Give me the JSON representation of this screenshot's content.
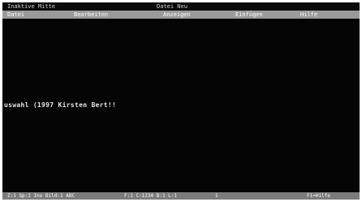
{
  "titlebar": {
    "left_text": "Inaktive Mitte",
    "center_text": "Datei Neu"
  },
  "menu": {
    "items": [
      {
        "label": "Datei"
      },
      {
        "label": "Bearbeiten"
      },
      {
        "label": "Anzeigen"
      },
      {
        "label": "Einfügen"
      },
      {
        "label": "Hilfe"
      }
    ]
  },
  "content": {
    "line": "uswahl (1997 Kirsten Bert!!"
  },
  "statusbar": {
    "segments": [
      {
        "text": "Z:1 Sp:1 Ins Bild:1 ABC"
      },
      {
        "text": "F:1 C:1234 B:1 L:1"
      },
      {
        "text": "1"
      },
      {
        "text": "F1=Hilfe"
      }
    ]
  },
  "colors": {
    "screen_bg": "#050505",
    "menubar_bg": "#9a9a9a",
    "statusbar_bg": "#7c7c7c",
    "text": "#e6e6e6"
  }
}
